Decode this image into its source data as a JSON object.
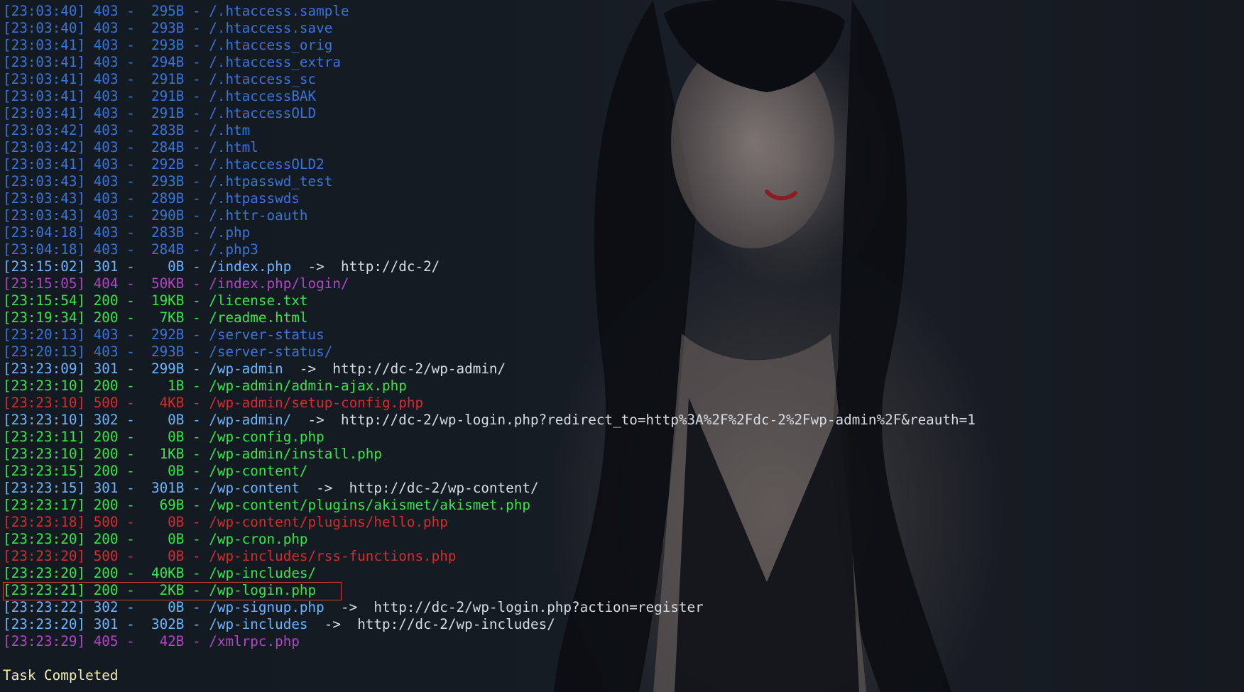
{
  "terminal": {
    "lines": [
      {
        "time": "[23:03:40]",
        "status": "403",
        "size": "295B",
        "path": "/.htaccess.sample",
        "color": "#3b74d8"
      },
      {
        "time": "[23:03:40]",
        "status": "403",
        "size": "293B",
        "path": "/.htaccess.save",
        "color": "#3b74d8"
      },
      {
        "time": "[23:03:41]",
        "status": "403",
        "size": "293B",
        "path": "/.htaccess_orig",
        "color": "#3b74d8"
      },
      {
        "time": "[23:03:41]",
        "status": "403",
        "size": "294B",
        "path": "/.htaccess_extra",
        "color": "#3b74d8"
      },
      {
        "time": "[23:03:41]",
        "status": "403",
        "size": "291B",
        "path": "/.htaccess_sc",
        "color": "#3b74d8"
      },
      {
        "time": "[23:03:41]",
        "status": "403",
        "size": "291B",
        "path": "/.htaccessBAK",
        "color": "#3b74d8"
      },
      {
        "time": "[23:03:41]",
        "status": "403",
        "size": "291B",
        "path": "/.htaccessOLD",
        "color": "#3b74d8"
      },
      {
        "time": "[23:03:42]",
        "status": "403",
        "size": "283B",
        "path": "/.htm",
        "color": "#3b74d8"
      },
      {
        "time": "[23:03:42]",
        "status": "403",
        "size": "284B",
        "path": "/.html",
        "color": "#3b74d8"
      },
      {
        "time": "[23:03:41]",
        "status": "403",
        "size": "292B",
        "path": "/.htaccessOLD2",
        "color": "#3b74d8"
      },
      {
        "time": "[23:03:43]",
        "status": "403",
        "size": "293B",
        "path": "/.htpasswd_test",
        "color": "#3b74d8"
      },
      {
        "time": "[23:03:43]",
        "status": "403",
        "size": "289B",
        "path": "/.htpasswds",
        "color": "#3b74d8"
      },
      {
        "time": "[23:03:43]",
        "status": "403",
        "size": "290B",
        "path": "/.httr-oauth",
        "color": "#3b74d8"
      },
      {
        "time": "[23:04:18]",
        "status": "403",
        "size": "283B",
        "path": "/.php",
        "color": "#3b74d8"
      },
      {
        "time": "[23:04:18]",
        "status": "403",
        "size": "284B",
        "path": "/.php3",
        "color": "#3b74d8"
      },
      {
        "time": "[23:15:02]",
        "status": "301",
        "size": "0B",
        "path": "/index.php",
        "redirect": "http://dc-2/",
        "color": "#6bb5ff"
      },
      {
        "time": "[23:15:05]",
        "status": "404",
        "size": "50KB",
        "path": "/index.php/login/",
        "color": "#b145c4"
      },
      {
        "time": "[23:15:54]",
        "status": "200",
        "size": "19KB",
        "path": "/license.txt",
        "color": "#38e54a"
      },
      {
        "time": "[23:19:34]",
        "status": "200",
        "size": "7KB",
        "path": "/readme.html",
        "color": "#38e54a"
      },
      {
        "time": "[23:20:13]",
        "status": "403",
        "size": "292B",
        "path": "/server-status",
        "color": "#3b74d8"
      },
      {
        "time": "[23:20:13]",
        "status": "403",
        "size": "293B",
        "path": "/server-status/",
        "color": "#3b74d8"
      },
      {
        "time": "[23:23:09]",
        "status": "301",
        "size": "299B",
        "path": "/wp-admin",
        "redirect": "http://dc-2/wp-admin/",
        "color": "#6bb5ff"
      },
      {
        "time": "[23:23:10]",
        "status": "200",
        "size": "1B",
        "path": "/wp-admin/admin-ajax.php",
        "color": "#38e54a"
      },
      {
        "time": "[23:23:10]",
        "status": "500",
        "size": "4KB",
        "path": "/wp-admin/setup-config.php",
        "color": "#d42d2d"
      },
      {
        "time": "[23:23:10]",
        "status": "302",
        "size": "0B",
        "path": "/wp-admin/",
        "redirect": "http://dc-2/wp-login.php?redirect_to=http%3A%2F%2Fdc-2%2Fwp-admin%2F&reauth=1",
        "color": "#6bb5ff"
      },
      {
        "time": "[23:23:11]",
        "status": "200",
        "size": "0B",
        "path": "/wp-config.php",
        "color": "#38e54a"
      },
      {
        "time": "[23:23:10]",
        "status": "200",
        "size": "1KB",
        "path": "/wp-admin/install.php",
        "color": "#38e54a"
      },
      {
        "time": "[23:23:15]",
        "status": "200",
        "size": "0B",
        "path": "/wp-content/",
        "color": "#38e54a"
      },
      {
        "time": "[23:23:15]",
        "status": "301",
        "size": "301B",
        "path": "/wp-content",
        "redirect": "http://dc-2/wp-content/",
        "color": "#6bb5ff"
      },
      {
        "time": "[23:23:17]",
        "status": "200",
        "size": "69B",
        "path": "/wp-content/plugins/akismet/akismet.php",
        "color": "#38e54a"
      },
      {
        "time": "[23:23:18]",
        "status": "500",
        "size": "0B",
        "path": "/wp-content/plugins/hello.php",
        "color": "#d42d2d"
      },
      {
        "time": "[23:23:20]",
        "status": "200",
        "size": "0B",
        "path": "/wp-cron.php",
        "color": "#38e54a"
      },
      {
        "time": "[23:23:20]",
        "status": "500",
        "size": "0B",
        "path": "/wp-includes/rss-functions.php",
        "color": "#d42d2d"
      },
      {
        "time": "[23:23:20]",
        "status": "200",
        "size": "40KB",
        "path": "/wp-includes/",
        "color": "#38e54a"
      },
      {
        "time": "[23:23:21]",
        "status": "200",
        "size": "2KB",
        "path": "/wp-login.php",
        "color": "#38e54a"
      },
      {
        "time": "[23:23:22]",
        "status": "302",
        "size": "0B",
        "path": "/wp-signup.php",
        "redirect": "http://dc-2/wp-login.php?action=register",
        "color": "#6bb5ff"
      },
      {
        "time": "[23:23:20]",
        "status": "301",
        "size": "302B",
        "path": "/wp-includes",
        "redirect": "http://dc-2/wp-includes/",
        "color": "#6bb5ff"
      },
      {
        "time": "[23:23:29]",
        "status": "405",
        "size": "42B",
        "path": "/xmlrpc.php",
        "color": "#b145c4"
      }
    ],
    "completion_message": "Task Completed",
    "highlight_color": "#d23b3b",
    "redirect_text_color": "#d7dce2",
    "completion_color": "#f1f0b0"
  }
}
